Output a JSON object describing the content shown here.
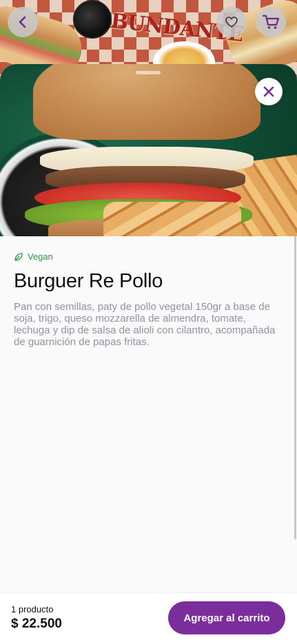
{
  "header": {
    "restaurant_logo_text": "ABUNDANTE",
    "back_icon": "chevron-left-icon",
    "favorite_icon": "heart-icon",
    "cart_icon": "cart-icon"
  },
  "product": {
    "diet_tag": "Vegan",
    "diet_icon": "leaf-icon",
    "name": "Burguer Re Pollo",
    "description": "Pan con semillas, paty de pollo vegetal 150gr a base de soja, trigo, queso mozzarella de almendra, tomate, lechuga y dip de salsa de alioli con cilantro, acompañada de guarnición de papas fritas."
  },
  "close_icon": "close-icon",
  "footer": {
    "quantity_label": "1 producto",
    "price": "$ 22.500",
    "add_button_label": "Agregar al carrito"
  },
  "colors": {
    "accent": "#7b2d9c",
    "diet_tag": "#2c9a48",
    "description_text": "#8e93a3"
  }
}
